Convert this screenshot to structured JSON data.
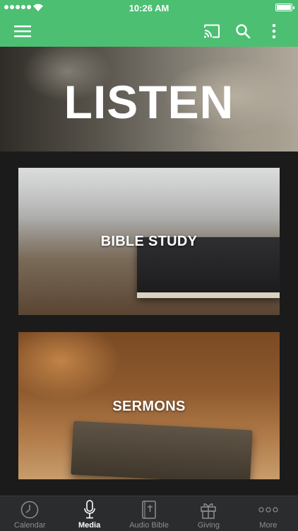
{
  "status_bar": {
    "time": "10:26 AM"
  },
  "app_bar": {
    "menu_icon": "hamburger-icon",
    "cast_icon": "cast-icon",
    "search_icon": "search-icon",
    "more_icon": "vertical-ellipsis-icon"
  },
  "hero": {
    "title": "LISTEN"
  },
  "cards": [
    {
      "label": "BIBLE STUDY"
    },
    {
      "label": "SERMONS"
    }
  ],
  "tabs": [
    {
      "label": "Calendar",
      "icon": "clock-icon",
      "active": false
    },
    {
      "label": "Media",
      "icon": "microphone-icon",
      "active": true
    },
    {
      "label": "Audio Bible",
      "icon": "bible-icon",
      "active": false
    },
    {
      "label": "Giving",
      "icon": "gift-icon",
      "active": false
    },
    {
      "label": "More",
      "icon": "more-dots-icon",
      "active": false
    }
  ],
  "colors": {
    "brand_green": "#4cbf73",
    "background": "#1b1b1c",
    "tabbar": "#2b2c2e",
    "tab_inactive": "#8d8e90"
  }
}
